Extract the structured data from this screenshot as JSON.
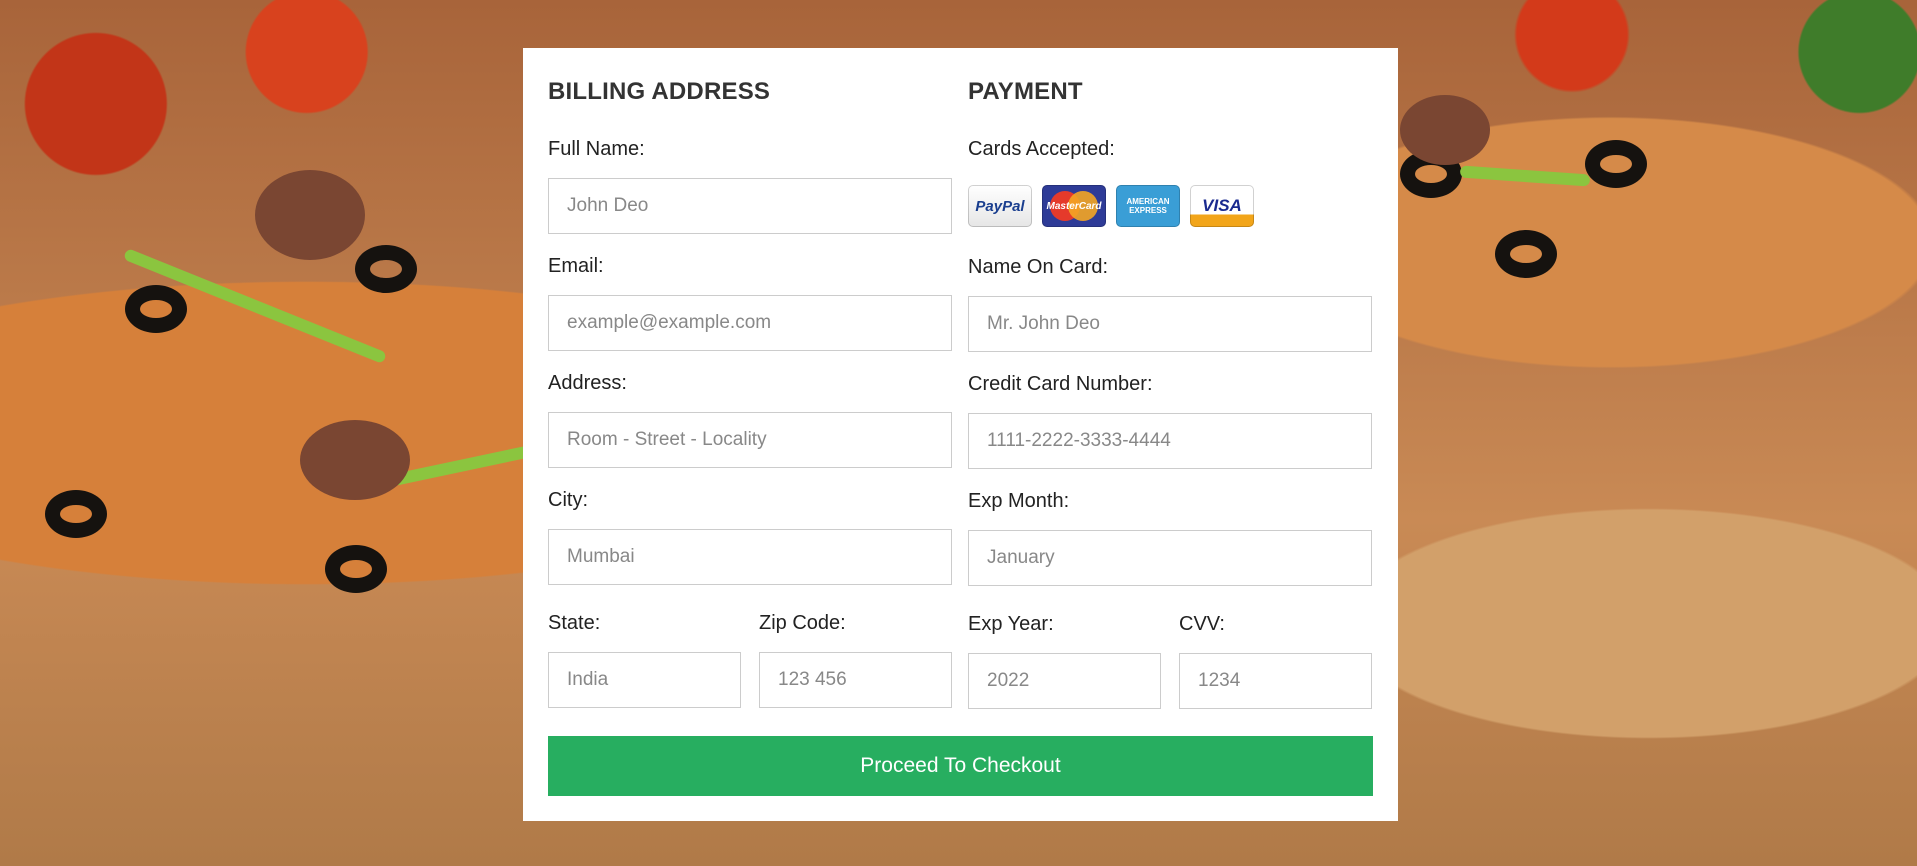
{
  "billing": {
    "title": "BILLING ADDRESS",
    "full_name": {
      "label": "Full Name:",
      "placeholder": "John Deo"
    },
    "email": {
      "label": "Email:",
      "placeholder": "example@example.com"
    },
    "address": {
      "label": "Address:",
      "placeholder": "Room - Street - Locality"
    },
    "city": {
      "label": "City:",
      "placeholder": "Mumbai"
    },
    "state": {
      "label": "State:",
      "placeholder": "India"
    },
    "zip": {
      "label": "Zip Code:",
      "placeholder": "123 456"
    }
  },
  "payment": {
    "title": "PAYMENT",
    "cards_accepted_label": "Cards Accepted:",
    "cards": [
      {
        "name": "PayPal",
        "icon": "paypal-icon"
      },
      {
        "name": "MasterCard",
        "icon": "mastercard-icon"
      },
      {
        "name": "AMERICAN EXPRESS",
        "icon": "amex-icon"
      },
      {
        "name": "VISA",
        "icon": "visa-icon"
      }
    ],
    "name_on_card": {
      "label": "Name On Card:",
      "placeholder": "Mr. John Deo"
    },
    "card_number": {
      "label": "Credit Card Number:",
      "placeholder": "1111-2222-3333-4444"
    },
    "exp_month": {
      "label": "Exp Month:",
      "placeholder": "January"
    },
    "exp_year": {
      "label": "Exp Year:",
      "placeholder": "2022"
    },
    "cvv": {
      "label": "CVV:",
      "placeholder": "1234"
    }
  },
  "checkout_button": "Proceed To Checkout",
  "colors": {
    "button": "#27ae60",
    "card_bg": "#ffffff",
    "heading": "#333333"
  }
}
